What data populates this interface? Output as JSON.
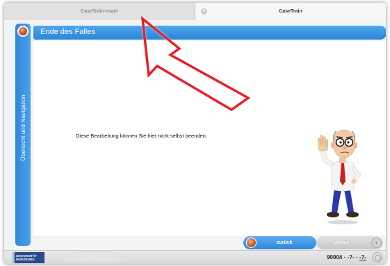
{
  "tabs": [
    {
      "label": "CaseTrain-exam",
      "active": false
    },
    {
      "label": "CaseTrain",
      "active": true
    }
  ],
  "tab_close_glyph": "⊗",
  "sidebar": {
    "label": "Übersicht und Navigation"
  },
  "header": {
    "title": "Ende des Falles"
  },
  "main": {
    "message": "Diese Bearbeitung können Sie hier nicht selbst beenden."
  },
  "buttons": {
    "back": "zurück",
    "next": "weiter"
  },
  "footer": {
    "logo_line1": "UNIVERSITÄT",
    "logo_line2": "WÜRZBURG",
    "case_id_prefix": "90004 · ",
    "case_id_a": "-?-",
    "case_id_sep": " · ",
    "case_id_b": "-?-"
  },
  "colors": {
    "accent_blue": "#2b85d7",
    "orb_orange": "#c9551f",
    "annotation_red": "#e8202a"
  },
  "icons": [
    "close-icon",
    "nav-orb-icon",
    "back-orb-icon",
    "next-chevron-icon",
    "help-icon",
    "annotation-arrow",
    "character-illustration"
  ]
}
